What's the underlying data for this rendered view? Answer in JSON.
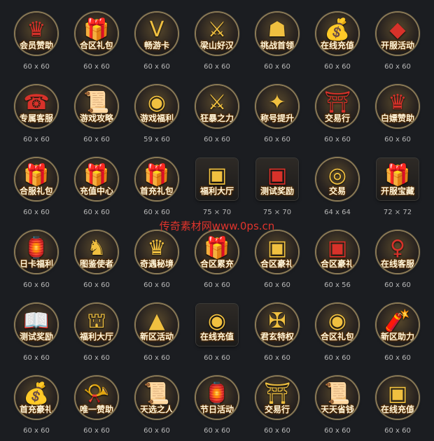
{
  "watermark": "传奇素材网www.0ps.cn",
  "rows": [
    [
      {
        "label": "会员赞助",
        "size": "60 x 60",
        "icon": "crown-icon",
        "glyph": "♛",
        "tone": "red"
      },
      {
        "label": "合区礼包",
        "size": "60 x 60",
        "icon": "gift-icon",
        "glyph": "🎁",
        "tone": "gold"
      },
      {
        "label": "畅游卡",
        "size": "60 x 60",
        "icon": "vip-icon",
        "glyph": "V",
        "tone": "gold"
      },
      {
        "label": "梁山好汉",
        "size": "60 x 60",
        "icon": "sword-icon",
        "glyph": "⚔",
        "tone": "gold"
      },
      {
        "label": "挑战首领",
        "size": "60 x 60",
        "icon": "helmet-icon",
        "glyph": "☗",
        "tone": "gold"
      },
      {
        "label": "在线充值",
        "size": "60 x 60",
        "icon": "money-bag-icon",
        "glyph": "💰",
        "tone": "red"
      },
      {
        "label": "开服活动",
        "size": "60 x 60",
        "icon": "gem-icon",
        "glyph": "◆",
        "tone": "red"
      }
    ],
    [
      {
        "label": "专属客服",
        "size": "60 x 60",
        "icon": "headset-icon",
        "glyph": "☎",
        "tone": "red"
      },
      {
        "label": "游戏攻略",
        "size": "60 x 60",
        "icon": "scroll-icon",
        "glyph": "📜",
        "tone": "gold"
      },
      {
        "label": "游戏福利",
        "size": "59 x 60",
        "icon": "gold-ingot-icon",
        "glyph": "◉",
        "tone": "gold"
      },
      {
        "label": "狂暴之力",
        "size": "60 x 60",
        "icon": "crossed-swords-icon",
        "glyph": "⚔",
        "tone": "gold"
      },
      {
        "label": "称号提升",
        "size": "60 x 60",
        "icon": "emblem-icon",
        "glyph": "✦",
        "tone": "gold"
      },
      {
        "label": "交易行",
        "size": "60 x 60",
        "icon": "palace-icon",
        "glyph": "⛩",
        "tone": "red"
      },
      {
        "label": "白嫖赞助",
        "size": "60 x 60",
        "icon": "crown-icon",
        "glyph": "♛",
        "tone": "red"
      }
    ],
    [
      {
        "label": "合服礼包",
        "size": "60 x 60",
        "icon": "gift-icon",
        "glyph": "🎁",
        "tone": "red"
      },
      {
        "label": "充值中心",
        "size": "60 x 60",
        "icon": "gift-icon",
        "glyph": "🎁",
        "tone": "gold"
      },
      {
        "label": "首充礼包",
        "size": "60 x 60",
        "icon": "gift-icon",
        "glyph": "🎁",
        "tone": "red"
      },
      {
        "label": "福利大厅",
        "size": "75 × 70",
        "icon": "treasure-chest-icon",
        "glyph": "▣",
        "tone": "gold",
        "square": true
      },
      {
        "label": "测试奖励",
        "size": "75 × 70",
        "icon": "treasure-chest-icon",
        "glyph": "▣",
        "tone": "red",
        "square": true
      },
      {
        "label": "交易",
        "size": "64 x 64",
        "icon": "coin-pile-icon",
        "glyph": "◎",
        "tone": "gold"
      },
      {
        "label": "开服宝藏",
        "size": "72 × 72",
        "icon": "gift-icon",
        "glyph": "🎁",
        "tone": "red",
        "square": true
      }
    ],
    [
      {
        "label": "日卡福利",
        "size": "60 x 60",
        "icon": "lantern-icon",
        "glyph": "🏮",
        "tone": "red"
      },
      {
        "label": "图鉴使者",
        "size": "60 x 60",
        "icon": "statue-icon",
        "glyph": "♞",
        "tone": "gold"
      },
      {
        "label": "奇遇秘境",
        "size": "60 x 60",
        "icon": "spiked-crown-icon",
        "glyph": "♛",
        "tone": "gold"
      },
      {
        "label": "合区累充",
        "size": "60 x 60",
        "icon": "gift-icon",
        "glyph": "🎁",
        "tone": "red"
      },
      {
        "label": "合区豪礼",
        "size": "60 x 60",
        "icon": "treasure-chest-icon",
        "glyph": "▣",
        "tone": "gold"
      },
      {
        "label": "合区豪礼",
        "size": "60 x 56",
        "icon": "treasure-chest-icon",
        "glyph": "▣",
        "tone": "red"
      },
      {
        "label": "在线客服",
        "size": "60 x 60",
        "icon": "lady-portrait-icon",
        "glyph": "♀",
        "tone": "red"
      }
    ],
    [
      {
        "label": "测试奖励",
        "size": "60 x 60",
        "icon": "book-icon",
        "glyph": "📖",
        "tone": "gold"
      },
      {
        "label": "福利大厅",
        "size": "60 x 60",
        "icon": "tower-icon",
        "glyph": "⛫",
        "tone": "gold"
      },
      {
        "label": "新区活动",
        "size": "60 x 60",
        "icon": "triangle-emblem-icon",
        "glyph": "▲",
        "tone": "gold"
      },
      {
        "label": "在线充值",
        "size": "60 x 60",
        "icon": "gold-pile-icon",
        "glyph": "◉",
        "tone": "gold",
        "square": true
      },
      {
        "label": "君玄特权",
        "size": "60 x 60",
        "icon": "winged-emblem-icon",
        "glyph": "✠",
        "tone": "gold"
      },
      {
        "label": "合区礼包",
        "size": "60 x 60",
        "icon": "gold-pile-icon",
        "glyph": "◉",
        "tone": "gold"
      },
      {
        "label": "新区助力",
        "size": "60 x 60",
        "icon": "firecracker-icon",
        "glyph": "🧨",
        "tone": "red"
      }
    ],
    [
      {
        "label": "首充豪礼",
        "size": "60 x 60",
        "icon": "money-bag-icon",
        "glyph": "💰",
        "tone": "red"
      },
      {
        "label": "唯一赞助",
        "size": "60 x 60",
        "icon": "horn-icon",
        "glyph": "📯",
        "tone": "gold"
      },
      {
        "label": "天选之人",
        "size": "60 x 60",
        "icon": "scroll-icon",
        "glyph": "📜",
        "tone": "gold"
      },
      {
        "label": "节日活动",
        "size": "60 x 60",
        "icon": "lantern-icon",
        "glyph": "🏮",
        "tone": "red"
      },
      {
        "label": "交易行",
        "size": "60 x 60",
        "icon": "pagoda-icon",
        "glyph": "⛩",
        "tone": "gold"
      },
      {
        "label": "天天省钱",
        "size": "60 x 60",
        "icon": "scroll-icon",
        "glyph": "📜",
        "tone": "gold"
      },
      {
        "label": "在线充值",
        "size": "60 x 60",
        "icon": "treasure-chest-icon",
        "glyph": "▣",
        "tone": "gold"
      }
    ]
  ]
}
